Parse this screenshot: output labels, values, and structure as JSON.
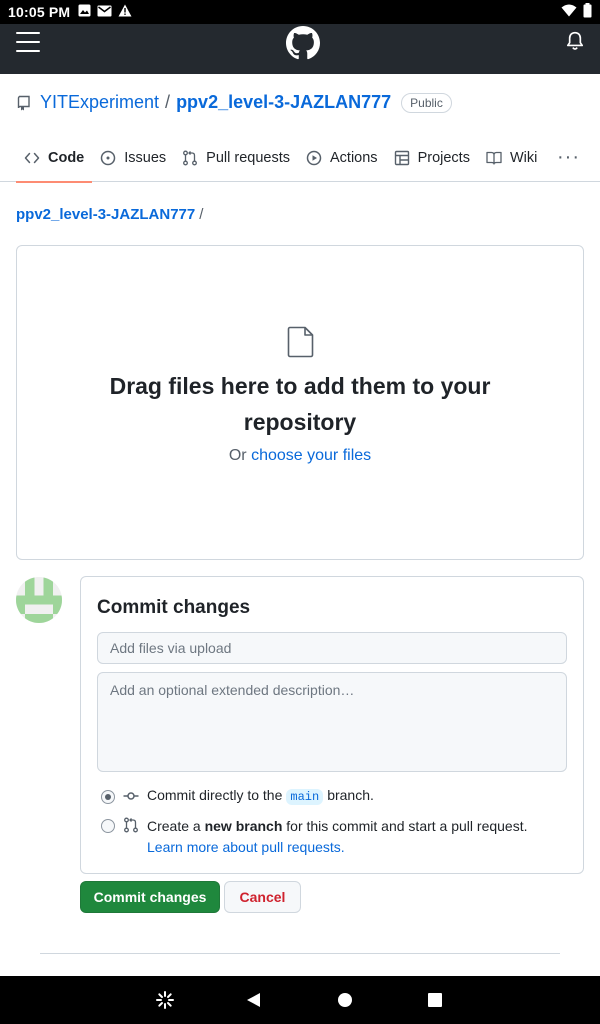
{
  "status_bar": {
    "time": "10:05 PM",
    "left_icons": [
      "image-icon",
      "mail-icon",
      "warning-icon"
    ],
    "right_icons": [
      "wifi-icon",
      "battery-icon"
    ]
  },
  "header": {
    "menu_icon": "hamburger-menu-icon",
    "logo_icon": "github-logo-icon",
    "notifications_icon": "bell-icon",
    "background": "#24292f"
  },
  "repo": {
    "owner": "YITExperiment",
    "separator": "/",
    "name": "ppv2_level-3-JAZLAN777",
    "visibility": "Public"
  },
  "tabs": [
    {
      "label": "Code",
      "icon": "code-icon",
      "active": true
    },
    {
      "label": "Issues",
      "icon": "issue-opened-icon",
      "active": false
    },
    {
      "label": "Pull requests",
      "icon": "git-pull-request-icon",
      "active": false
    },
    {
      "label": "Actions",
      "icon": "play-icon",
      "active": false
    },
    {
      "label": "Projects",
      "icon": "table-icon",
      "active": false
    },
    {
      "label": "Wiki",
      "icon": "book-icon",
      "active": false
    }
  ],
  "tabs_more": "···",
  "breadcrumb": {
    "repo": "ppv2_level-3-JAZLAN777",
    "slash": "/"
  },
  "dropzone": {
    "icon": "file-icon",
    "headline": "Drag files here to add them to your repository",
    "or_text": "Or",
    "choose_link": "choose your files"
  },
  "commit": {
    "title": "Commit changes",
    "summary_placeholder": "Add files via upload",
    "description_placeholder": "Add an optional extended description…",
    "option_direct": {
      "prefix": "Commit directly to the",
      "branch": "main",
      "suffix": "branch.",
      "checked": true,
      "icon": "git-commit-icon"
    },
    "option_new_branch": {
      "prefix": "Create a",
      "bold": "new branch",
      "suffix": "for this commit and start a pull request.",
      "link": "Learn more about pull requests.",
      "checked": false,
      "icon": "git-pull-request-icon"
    },
    "submit_label": "Commit changes",
    "cancel_label": "Cancel",
    "submit_color": "#1f883d",
    "cancel_color": "#cf222e"
  },
  "nav_bar": {
    "icons": [
      "assistant-icon",
      "back-icon",
      "home-icon",
      "recents-icon"
    ]
  }
}
